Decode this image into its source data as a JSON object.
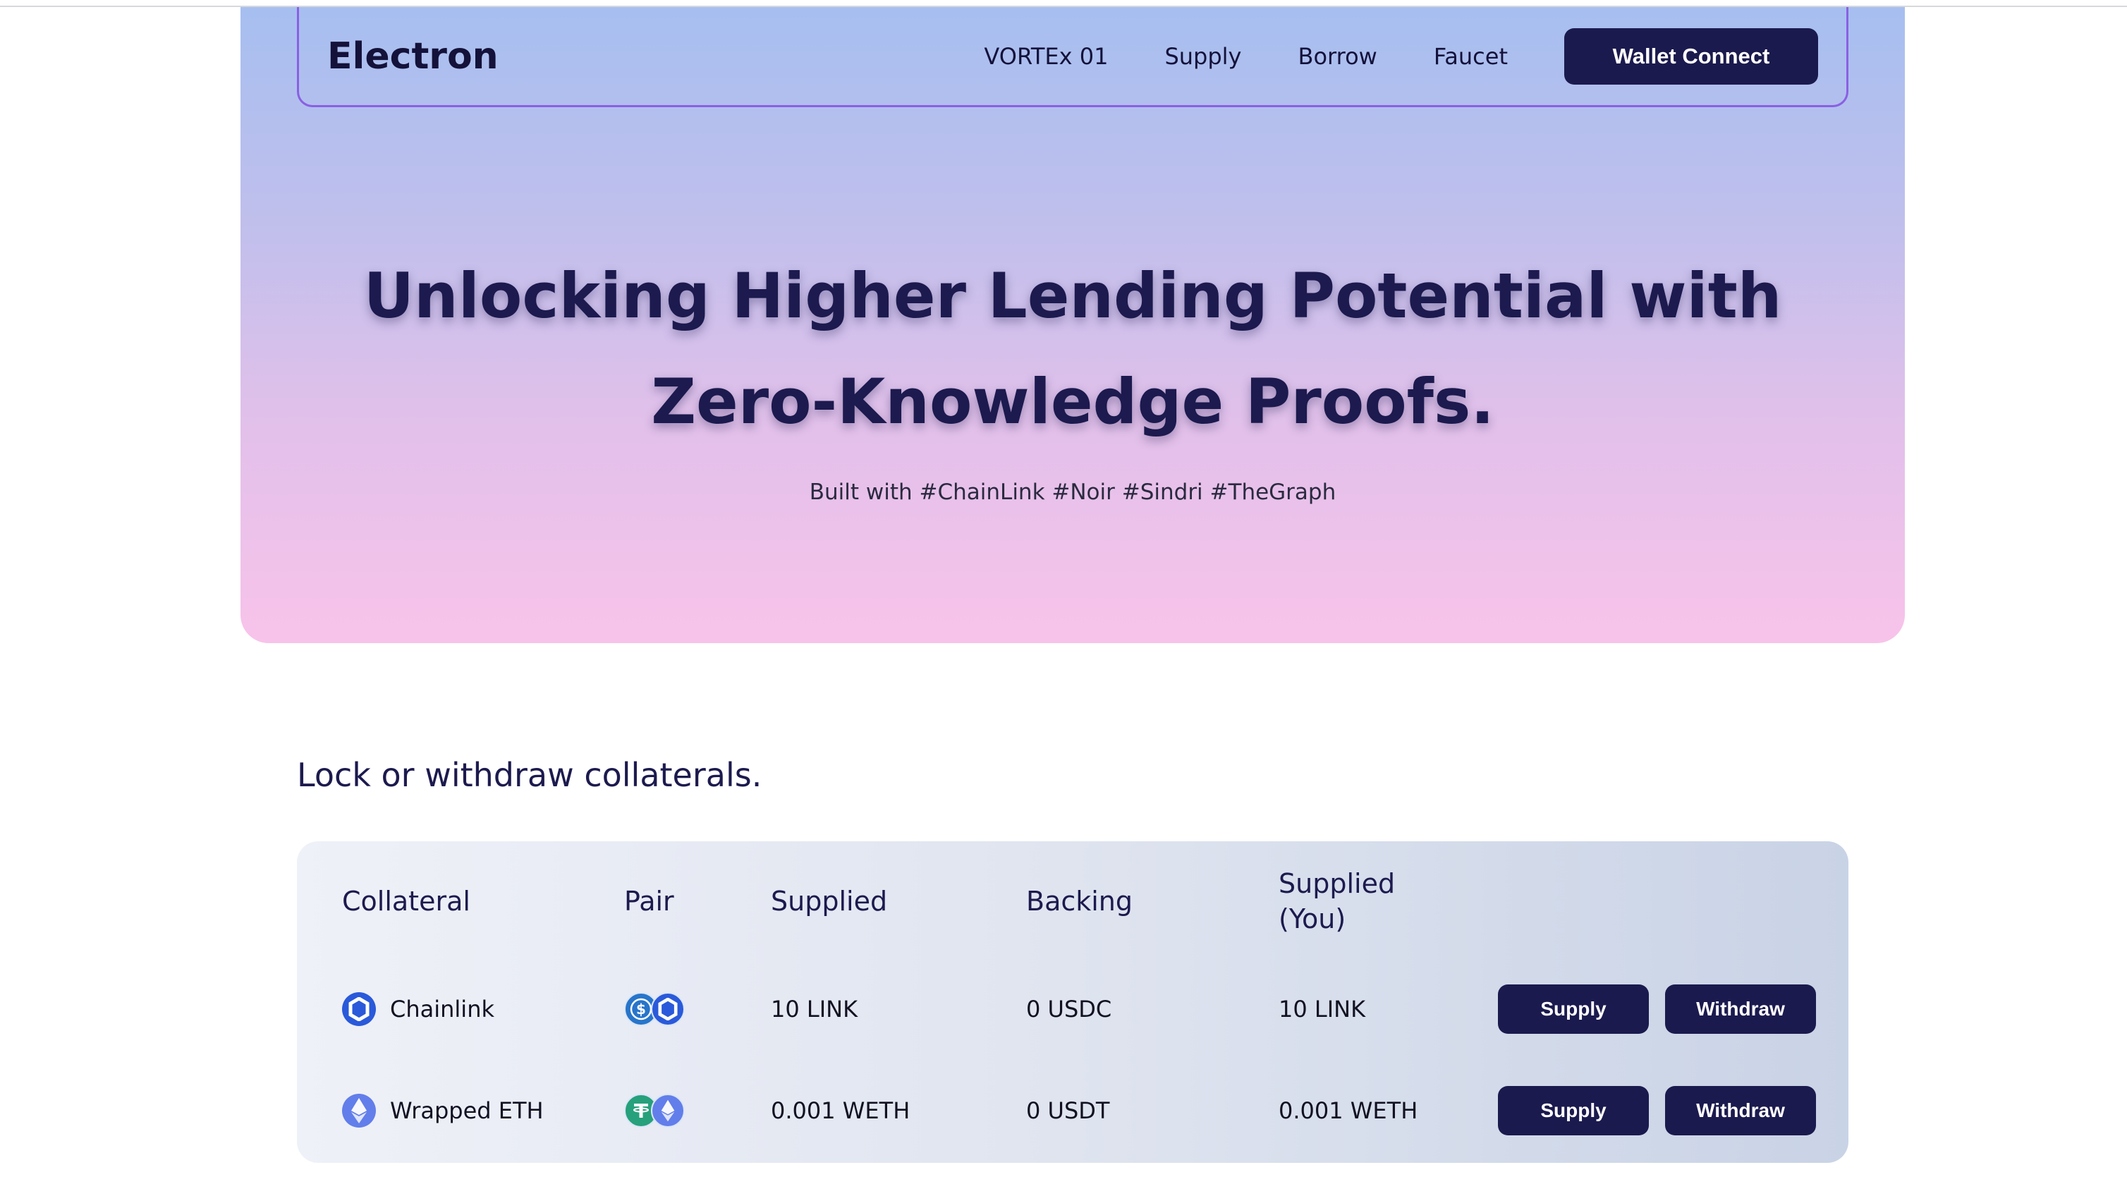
{
  "nav": {
    "logo": "Electron",
    "links": [
      "VORTEx 01",
      "Supply",
      "Borrow",
      "Faucet"
    ],
    "wallet_button": "Wallet Connect"
  },
  "hero": {
    "title": "Unlocking Higher Lending Potential with Zero-Knowledge Proofs.",
    "subtitle": "Built with #ChainLink #Noir #Sindri #TheGraph"
  },
  "section": {
    "title": "Lock or withdraw collaterals."
  },
  "table": {
    "headers": {
      "collateral": "Collateral",
      "pair": "Pair",
      "supplied": "Supplied",
      "backing": "Backing",
      "supplied_you": "Supplied (You)"
    },
    "rows": [
      {
        "collateral": "Chainlink",
        "icon": "chainlink-icon",
        "pair_icons": [
          "usdc-icon",
          "chainlink-icon"
        ],
        "supplied": "10 LINK",
        "backing": "0 USDC",
        "supplied_you": "10 LINK",
        "supply_label": "Supply",
        "withdraw_label": "Withdraw"
      },
      {
        "collateral": "Wrapped ETH",
        "icon": "ethereum-icon",
        "pair_icons": [
          "tether-icon",
          "ethereum-icon"
        ],
        "supplied": "0.001 WETH",
        "backing": "0 USDT",
        "supplied_you": "0.001 WETH",
        "supply_label": "Supply",
        "withdraw_label": "Withdraw"
      }
    ]
  },
  "colors": {
    "primary": "#1b1a4e",
    "chainlink": "#2a5ada",
    "usdc": "#2775ca",
    "ethereum": "#627eea",
    "tether": "#26a17b",
    "nav_border": "#8a60e2"
  }
}
